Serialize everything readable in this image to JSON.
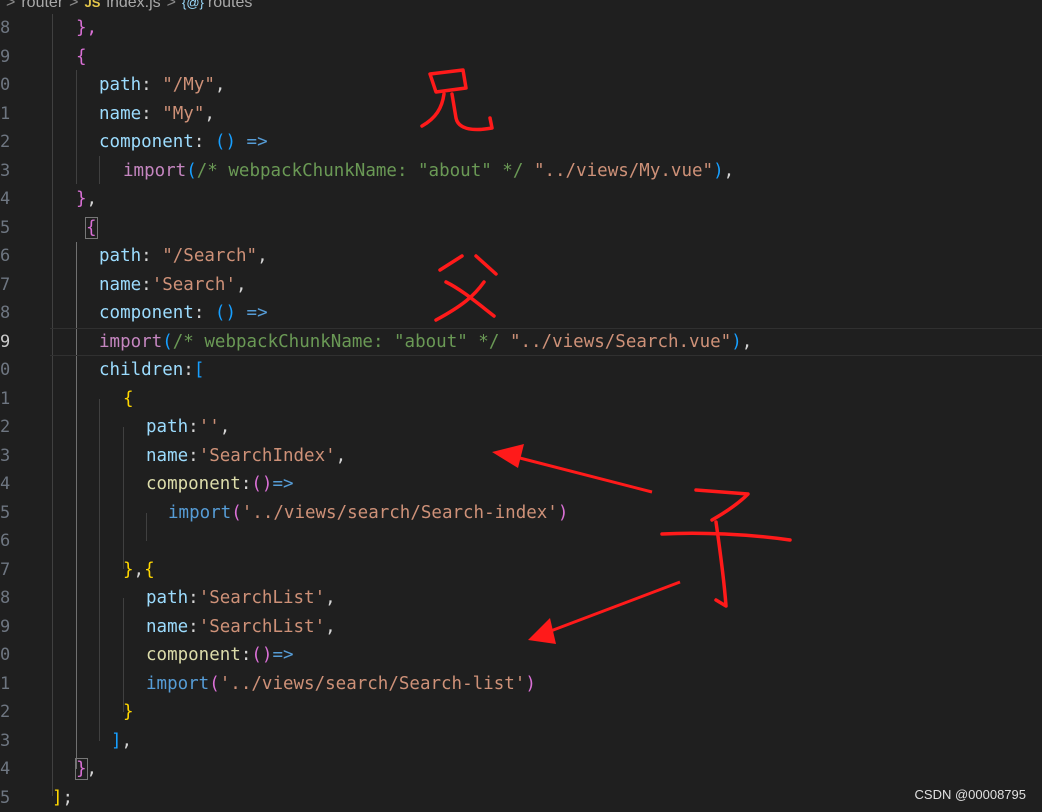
{
  "breadcrumb": {
    "folder": "router",
    "file_badge": "JS",
    "file": "index.js",
    "symbol_icon": "{@}",
    "symbol": "routes"
  },
  "line_numbers": [
    "8",
    "9",
    "0",
    "1",
    "2",
    "3",
    "4",
    "5",
    "6",
    "7",
    "8",
    "9",
    "0",
    "1",
    "2",
    "3",
    "4",
    "5",
    "6",
    "7",
    "8",
    "9",
    "0",
    "1",
    "2",
    "3",
    "4",
    "5"
  ],
  "code": {
    "l8": [
      "},"
    ],
    "l9": [
      "{"
    ],
    "l10": [
      "path",
      ": ",
      "\"/My\"",
      ","
    ],
    "l11": [
      "name",
      ": ",
      "\"My\"",
      ","
    ],
    "l12": [
      "component",
      ": ",
      "()",
      " ",
      "=>"
    ],
    "l13": [
      "import",
      "(",
      "/* webpackChunkName: \"about\" */",
      " ",
      "\"../views/My.vue\"",
      ")",
      ","
    ],
    "l14": [
      "}",
      ","
    ],
    "l15": [
      "{"
    ],
    "l16": [
      "path",
      ": ",
      "\"/Search\"",
      ","
    ],
    "l17": [
      "name",
      ":",
      "'Search'",
      ","
    ],
    "l18": [
      "component",
      ": ",
      "()",
      " ",
      "=>"
    ],
    "l19": [
      "import",
      "(",
      "/* webpackChunkName: \"about\" */",
      " ",
      "\"../views/Search.vue\"",
      ")",
      ","
    ],
    "l20": [
      "children",
      ":",
      "["
    ],
    "l21": [
      "{"
    ],
    "l22": [
      "path",
      ":",
      "''",
      ","
    ],
    "l23": [
      "name",
      ":",
      "'SearchIndex'",
      ","
    ],
    "l24": [
      "component",
      ":",
      "()",
      "=>"
    ],
    "l25": [
      "import",
      "(",
      "'../views/search/Search-index'",
      ")"
    ],
    "l26": [
      ""
    ],
    "l27": [
      "}",
      ",",
      "{"
    ],
    "l28": [
      "path",
      ":",
      "'SearchList'",
      ","
    ],
    "l29": [
      "name",
      ":",
      "'SearchList'",
      ","
    ],
    "l30": [
      "component",
      ":",
      "()",
      "=>"
    ],
    "l31": [
      "import",
      "(",
      "'../views/search/Search-list'",
      ")"
    ],
    "l32": [
      "}"
    ],
    "l33": [
      "]",
      ","
    ],
    "l34": [
      "}",
      ","
    ],
    "l35": [
      "]",
      ";"
    ]
  },
  "annotations": {
    "brother_char": "兄",
    "parent_char": "父",
    "child_char": "子",
    "ink_color": "#ff1a1a"
  },
  "watermark": "CSDN @00008795",
  "colors": {
    "background": "#1f1f1f",
    "property": "#9cdcfe",
    "string": "#ce9178",
    "comment": "#6a9955",
    "keyword": "#569cd6",
    "bracket_level1": "#da70d6",
    "bracket_level2": "#179fff",
    "bracket_level3": "#ffd700"
  }
}
